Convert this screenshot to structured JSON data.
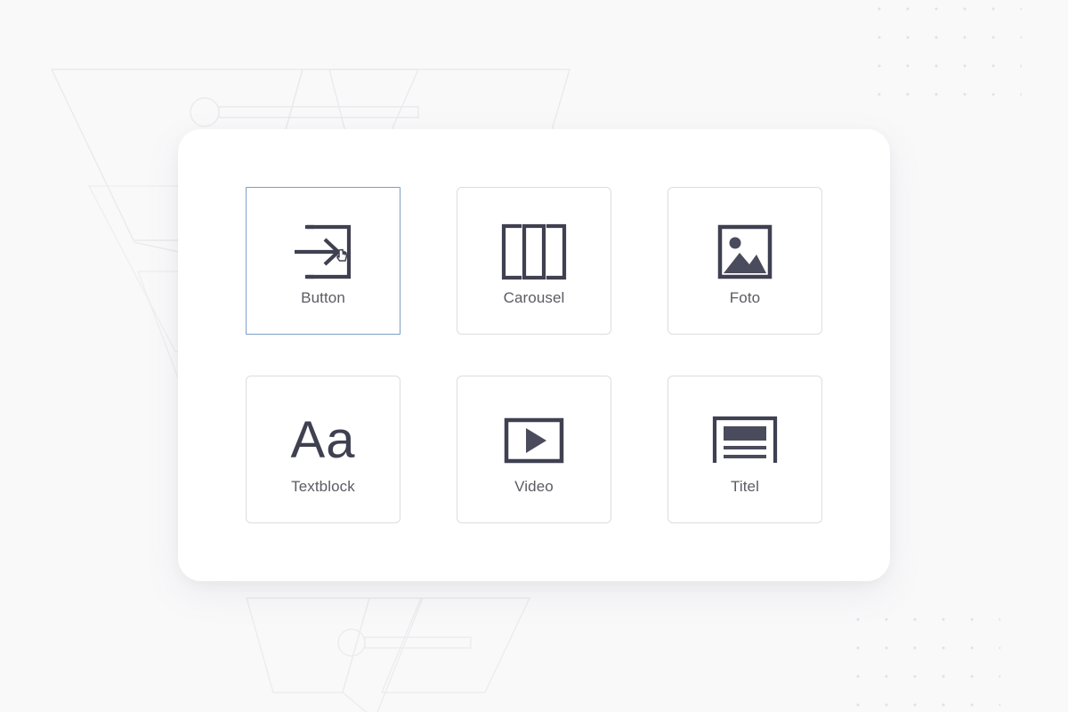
{
  "background": {
    "page_color": "#faf9fa",
    "watermark_color": "#ececed",
    "dot_color": "#e2e1e3",
    "decorations": [
      {
        "name": "watermark-logo-top-left"
      },
      {
        "name": "watermark-logo-bottom-left"
      },
      {
        "name": "dot-grid-top-right"
      },
      {
        "name": "dot-grid-bottom-right"
      }
    ]
  },
  "panel": {
    "background_color": "#ffffff",
    "border_radius": "26px"
  },
  "picker": {
    "selected_index": 0,
    "selected_border_color": "#7d9fc4",
    "card_border_color": "#dddde0",
    "icon_color": "#3f4050",
    "label_color": "#5b5b63",
    "cards": [
      {
        "label": "Button",
        "icon": "button-enter-arrow-icon"
      },
      {
        "label": "Carousel",
        "icon": "carousel-slides-icon"
      },
      {
        "label": "Foto",
        "icon": "photo-image-icon"
      },
      {
        "label": "Textblock",
        "icon": "text-aa-icon",
        "glyph": "Aa"
      },
      {
        "label": "Video",
        "icon": "video-play-icon"
      },
      {
        "label": "Titel",
        "icon": "title-heading-icon"
      }
    ]
  }
}
